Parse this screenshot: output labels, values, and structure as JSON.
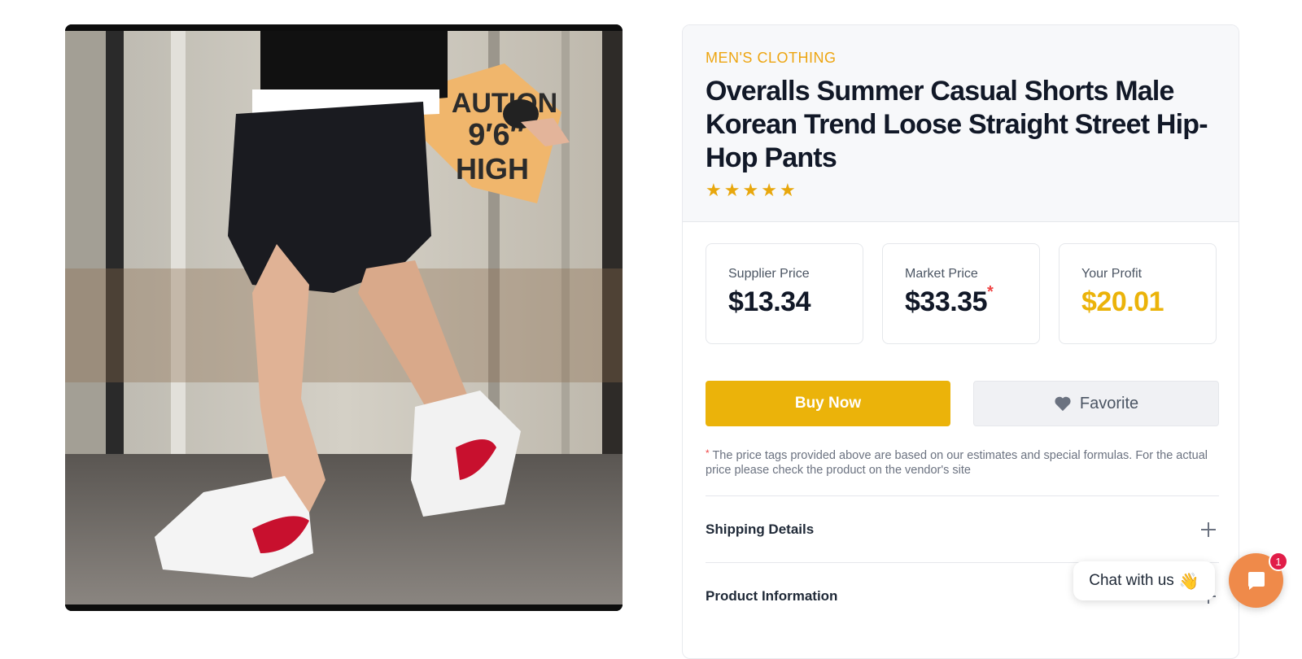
{
  "product": {
    "category": "MEN'S CLOTHING",
    "title": "Overalls Summer Casual Shorts Male Korean Trend Loose Straight Street Hip-Hop Pants",
    "rating": 5,
    "image_sign": [
      "AUTION",
      "9′6″",
      "HIGH"
    ]
  },
  "prices": {
    "supplier": {
      "label": "Supplier Price",
      "value": "$13.34"
    },
    "market": {
      "label": "Market Price",
      "value": "$33.35",
      "asterisk": "*"
    },
    "profit": {
      "label": "Your Profit",
      "value": "$20.01"
    }
  },
  "actions": {
    "buy_label": "Buy Now",
    "favorite_label": "Favorite"
  },
  "note": {
    "asterisk": "*",
    "text": "The price tags provided above are based on our estimates and special formulas. For the actual price please check the product on the vendor's site"
  },
  "accordion": [
    {
      "label": "Shipping Details"
    },
    {
      "label": "Product Information"
    }
  ],
  "chat": {
    "label": "Chat with us",
    "wave": "👋",
    "badge": "1"
  },
  "colors": {
    "accent": "#ebb30a",
    "category": "#eda511",
    "chat": "#ef8a4a",
    "badge": "#e11d48"
  }
}
